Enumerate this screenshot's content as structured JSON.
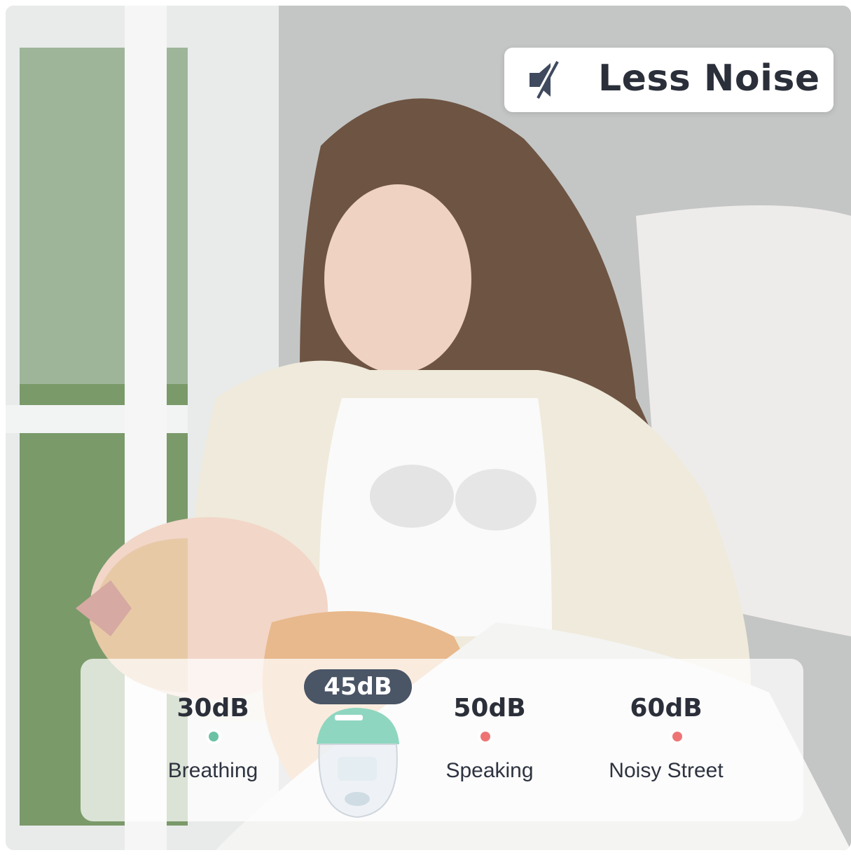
{
  "badge": {
    "icon": "muted-speaker-icon",
    "title": "Less Noise"
  },
  "scale": {
    "current_level": "45dB",
    "levels": [
      {
        "value": "30dB",
        "label": "Breathing"
      },
      {
        "value": "50dB",
        "label": "Speaking"
      },
      {
        "value": "60dB",
        "label": "Noisy Street"
      }
    ]
  },
  "colors": {
    "quiet": "#6bc1a4",
    "loud": "#ee7474",
    "current_badge": "#4a5566",
    "heading_text": "#2a2f3a"
  }
}
